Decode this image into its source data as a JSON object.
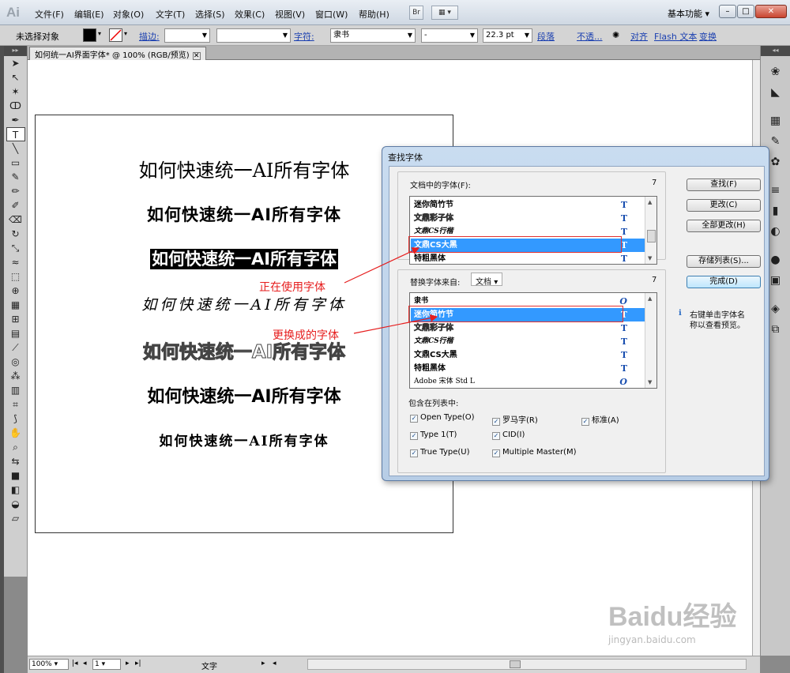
{
  "app": {
    "logo": "Ai",
    "workspace": "基本功能 ▾"
  },
  "menu": [
    "文件(F)",
    "编辑(E)",
    "对象(O)",
    "文字(T)",
    "选择(S)",
    "效果(C)",
    "视图(V)",
    "窗口(W)",
    "帮助(H)"
  ],
  "menubar_buttons": {
    "bridge": "Br",
    "arrange": "▦ ▾"
  },
  "window_buttons": {
    "minimize": "–",
    "maximize": "□",
    "close": "✕"
  },
  "controlbar": {
    "no_selection": "未选择对象",
    "stroke_label": "描边:",
    "character_label": "字符:",
    "font_family": "隶书",
    "font_style": "-",
    "font_size": "22.3 pt",
    "paragraph": "段落",
    "opacity": "不透...",
    "align": "对齐",
    "flash_text": "Flash 文本",
    "transform": "变换"
  },
  "document_tab": {
    "title": "如何统一AI界面字体* @ 100% (RGB/预览)",
    "close": "✕"
  },
  "artboard_samples": [
    "如何快速统一AI所有字体",
    "如何快速统一AI所有字体",
    "如何快速统一AI所有字体",
    "如何快速统一AI所有字体",
    "如何快速统一AI所有字体",
    "如何快速统一AI所有字体",
    "如何快速统一AI所有字体"
  ],
  "annotations": {
    "in_use": "正在使用字体",
    "replace_with": "更换成的字体"
  },
  "dialog": {
    "title": "查找字体",
    "doc_fonts_label": "文档中的字体(F):",
    "doc_fonts_count": "7",
    "doc_fonts": [
      {
        "name": "迷你简竹节",
        "icon": "T",
        "selected": false
      },
      {
        "name": "文鼎彩子体",
        "icon": "T",
        "selected": false
      },
      {
        "name": "文鼎CS行楷",
        "icon": "T",
        "selected": false
      },
      {
        "name": "文鼎CS大黑",
        "icon": "T",
        "selected": true
      },
      {
        "name": "特粗黑体",
        "icon": "T",
        "selected": false
      }
    ],
    "replace_from_label": "替换字体来自:",
    "replace_from_value": "文档",
    "replace_count": "7",
    "replace_fonts": [
      {
        "name": "隶书",
        "icon": "O",
        "selected": false
      },
      {
        "name": "迷你简竹节",
        "icon": "T",
        "selected": true
      },
      {
        "name": "文鼎彩子体",
        "icon": "T",
        "selected": false
      },
      {
        "name": "文鼎CS行楷",
        "icon": "T",
        "selected": false
      },
      {
        "name": "文鼎CS大黑",
        "icon": "T",
        "selected": false
      },
      {
        "name": "特粗黑体",
        "icon": "T",
        "selected": false
      },
      {
        "name": "Adobe 宋体 Std L",
        "icon": "O",
        "selected": false
      }
    ],
    "include_label": "包含在列表中:",
    "checks": [
      {
        "label": "Open Type(O)",
        "checked": true
      },
      {
        "label": "罗马字(R)",
        "checked": true
      },
      {
        "label": "标准(A)",
        "checked": true
      },
      {
        "label": "Type 1(T)",
        "checked": true
      },
      {
        "label": "CID(I)",
        "checked": true
      },
      {
        "label": "True Type(U)",
        "checked": true
      },
      {
        "label": "Multiple Master(M)",
        "checked": true
      }
    ],
    "buttons": {
      "find": "查找(F)",
      "change": "更改(C)",
      "change_all": "全部更改(H)",
      "save_list": "存储列表(S)...",
      "done": "完成(D)"
    },
    "hint": "右键单击字体名称以查看预览。",
    "hint_line1": "右键单击字体名",
    "hint_line2": "称以查看预览。"
  },
  "statusbar": {
    "zoom": "100%",
    "page": "1",
    "tool": "文字"
  },
  "watermark": {
    "logo": "Baidu经验",
    "url": "jingyan.baidu.com"
  }
}
